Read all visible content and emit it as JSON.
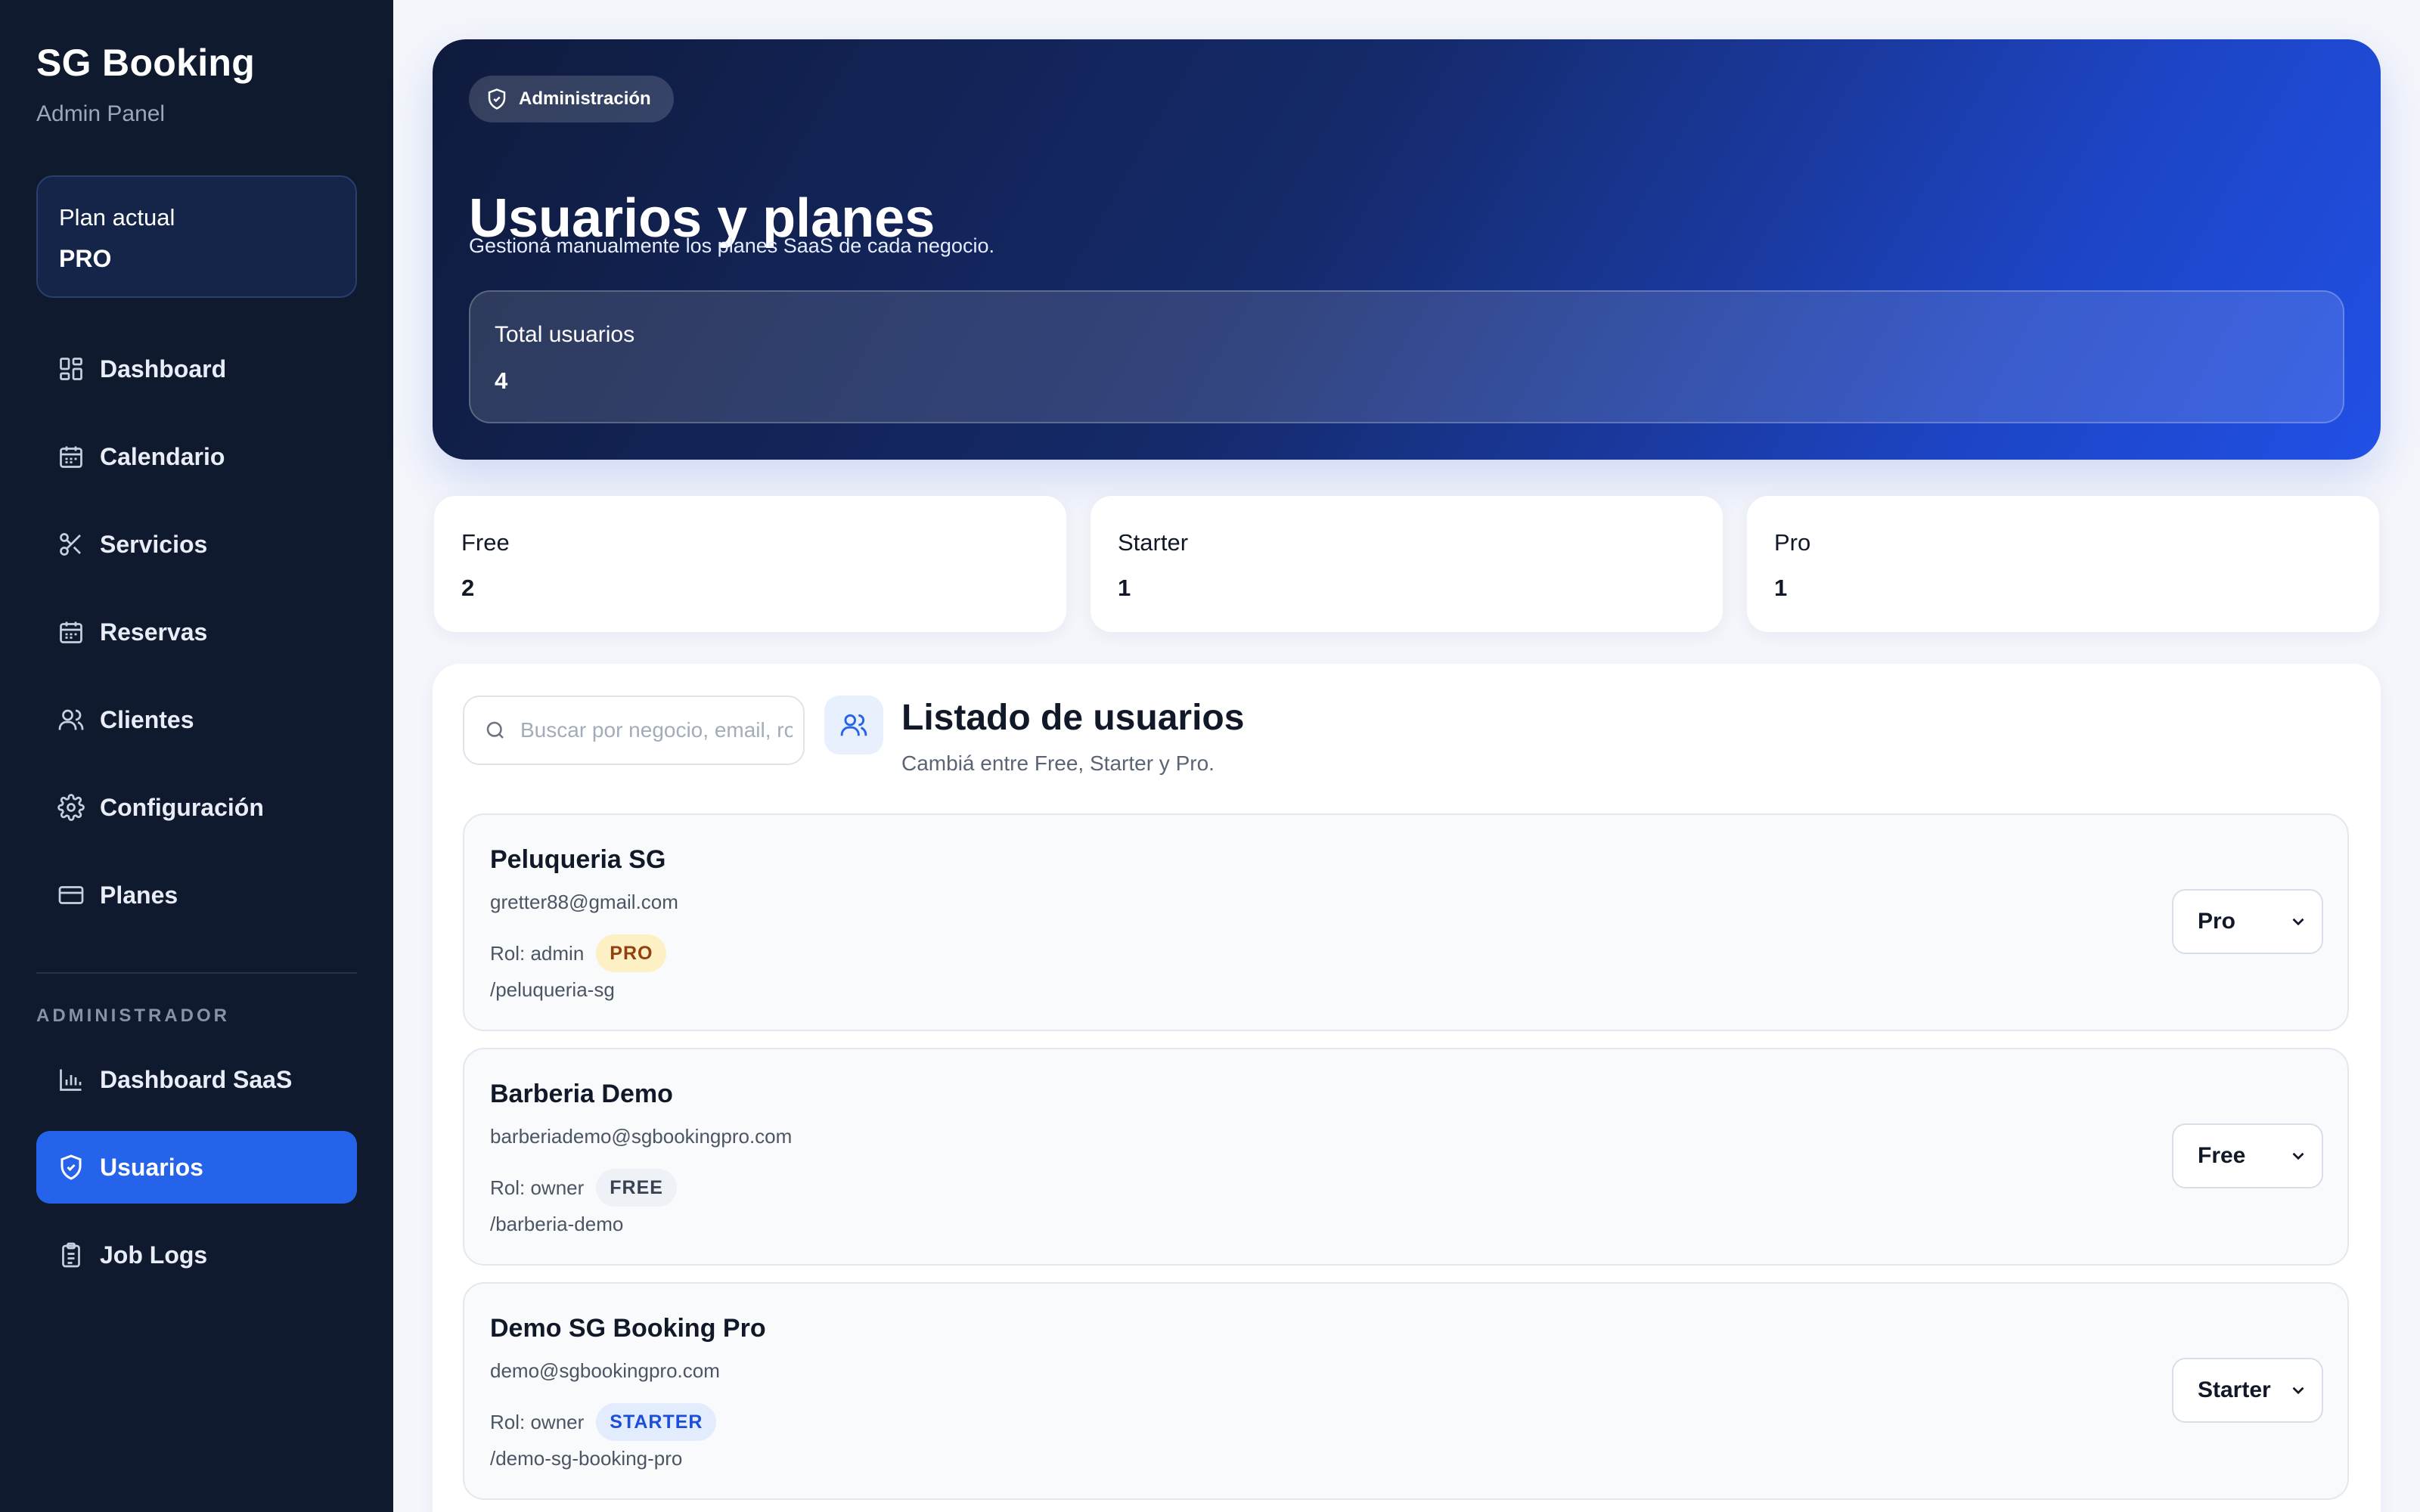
{
  "sidebar": {
    "brand": "SG Booking",
    "subtitle": "Admin Panel",
    "plan": {
      "label": "Plan actual",
      "value": "PRO"
    },
    "nav": [
      {
        "label": "Dashboard",
        "icon": "dashboard-icon"
      },
      {
        "label": "Calendario",
        "icon": "calendar-icon"
      },
      {
        "label": "Servicios",
        "icon": "scissors-icon"
      },
      {
        "label": "Reservas",
        "icon": "calendar-icon"
      },
      {
        "label": "Clientes",
        "icon": "users-icon"
      },
      {
        "label": "Configuración",
        "icon": "gear-icon"
      },
      {
        "label": "Planes",
        "icon": "credit-card-icon"
      }
    ],
    "admin_section_label": "ADMINISTRADOR",
    "admin_nav": [
      {
        "label": "Dashboard SaaS",
        "icon": "bar-chart-icon"
      },
      {
        "label": "Usuarios",
        "icon": "shield-icon",
        "active": true
      },
      {
        "label": "Job Logs",
        "icon": "clipboard-icon"
      }
    ]
  },
  "hero": {
    "badge": "Administración",
    "title": "Usuarios y planes",
    "subtitle": "Gestioná manualmente los planes SaaS de cada negocio.",
    "total": {
      "label": "Total usuarios",
      "value": "4"
    }
  },
  "plan_counts": [
    {
      "label": "Free",
      "value": "2"
    },
    {
      "label": "Starter",
      "value": "1"
    },
    {
      "label": "Pro",
      "value": "1"
    }
  ],
  "users_list": {
    "search_placeholder": "Buscar por negocio, email, rol o plan",
    "title": "Listado de usuarios",
    "subtitle": "Cambiá entre Free, Starter y Pro.",
    "role_prefix": "Rol:",
    "users": [
      {
        "name": "Peluqueria SG",
        "email": "gretter88@gmail.com",
        "role": "Rol: admin",
        "plan_badge": "PRO",
        "slug": "/peluqueria-sg",
        "selected_plan": "Pro"
      },
      {
        "name": "Barberia Demo",
        "email": "barberiademo@sgbookingpro.com",
        "role": "Rol: owner",
        "plan_badge": "FREE",
        "slug": "/barberia-demo",
        "selected_plan": "Free"
      },
      {
        "name": "Demo SG Booking Pro",
        "email": "demo@sgbookingpro.com",
        "role": "Rol: owner",
        "plan_badge": "STARTER",
        "slug": "/demo-sg-booking-pro",
        "selected_plan": "Starter"
      }
    ]
  },
  "colors": {
    "sidebar_bg": "#101a2e",
    "accent": "#2563eb",
    "hero_gradient_start": "#0f1b3d",
    "hero_gradient_end": "#2150e6",
    "badge_pro_bg": "#fdf0c4",
    "badge_starter_text": "#1d4ed8"
  }
}
